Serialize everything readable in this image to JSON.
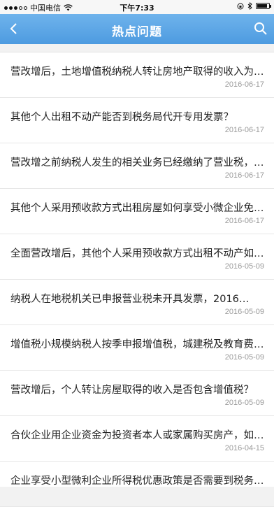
{
  "status_bar": {
    "carrier": "中国电信",
    "time": "下午7:33",
    "battery_level": 0.85
  },
  "navbar": {
    "title": "热点问题",
    "back_icon": "chevron-left-icon",
    "search_icon": "search-icon"
  },
  "colors": {
    "nav_top": "#6fb3ec",
    "nav_bottom": "#4d9be0",
    "date": "#9a9a9a"
  },
  "items": [
    {
      "title": "营改增后，土地增值税纳税人转让房地产取得的收入为不含增值税收入吗？",
      "date": "2016-06-17"
    },
    {
      "title": "其他个人出租不动产能否到税务局代开专用发票？",
      "date": "2016-06-17"
    },
    {
      "title": "营改增之前纳税人发生的相关业务已经缴纳了营业税，营改增后怎么处理？",
      "date": "2016-06-17"
    },
    {
      "title": "其他个人采用预收款方式出租房屋如何享受小微企业免税政策？",
      "date": "2016-06-17"
    },
    {
      "title": "全面营改增后，其他个人采用预收款方式出租不动产如何纳税？",
      "date": "2016-05-09"
    },
    {
      "title": "纳税人在地税机关已申报营业税未开具发票，2016…",
      "date": "2016-05-09"
    },
    {
      "title": "增值税小规模纳税人按季申报增值税，城建税及教育费附加怎么申报？",
      "date": "2016-05-09"
    },
    {
      "title": "营改增后，个人转让房屋取得的收入是否包含增值税？",
      "date": "2016-05-09"
    },
    {
      "title": "合伙企业用企业资金为投资者本人或家属购买房产，如何纳税？",
      "date": "2016-04-15"
    },
    {
      "title": "企业享受小型微利企业所得税优惠政策是否需要到税务机关备案？",
      "date": ""
    }
  ]
}
